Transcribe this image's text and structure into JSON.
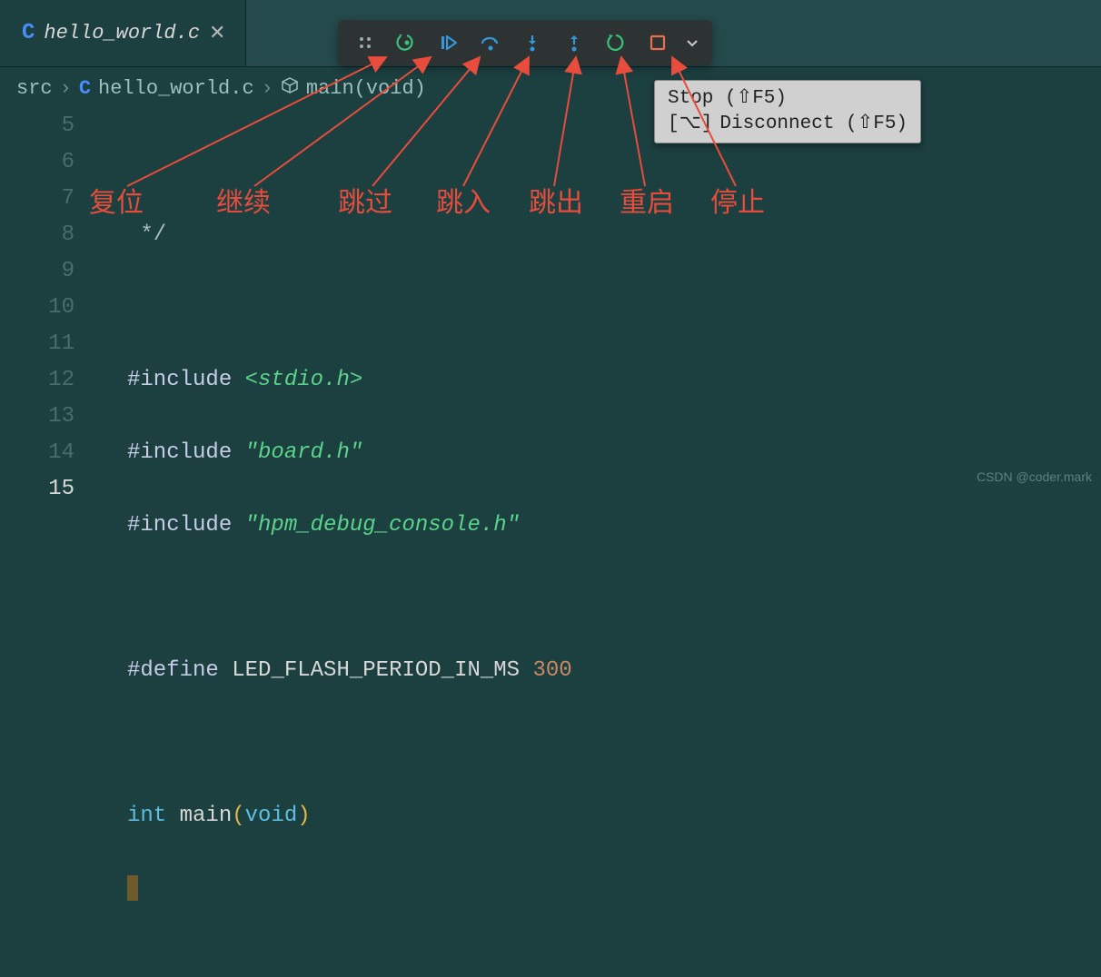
{
  "tab": {
    "icon_letter": "C",
    "filename": "hello_world.c",
    "close": "✕"
  },
  "debug": {
    "buttons": [
      {
        "name": "reset",
        "icon": "restart-back"
      },
      {
        "name": "continue",
        "icon": "play"
      },
      {
        "name": "step-over",
        "icon": "step-over"
      },
      {
        "name": "step-into",
        "icon": "step-in"
      },
      {
        "name": "step-out",
        "icon": "step-out"
      },
      {
        "name": "restart",
        "icon": "restart"
      },
      {
        "name": "stop",
        "icon": "stop"
      }
    ]
  },
  "breadcrumb": {
    "folder": "src",
    "file": "hello_world.c",
    "symbol": "main(void)"
  },
  "tooltip": {
    "line1": "Stop (⇧F5)",
    "line2_left": "[⌥]",
    "line2_rest": "Disconnect (⇧F5)"
  },
  "gutter_lines": [
    "5",
    "6",
    "7",
    "8",
    "9",
    "10",
    "11",
    "12",
    "13",
    "14",
    "15"
  ],
  "code_lines": {
    "l5": "",
    "l6": " */",
    "l7": "",
    "l8_a": "#include",
    "l8_b": "<stdio.h>",
    "l9_a": "#include",
    "l9_b": "\"board.h\"",
    "l10_a": "#include",
    "l10_b": "\"hpm_debug_console.h\"",
    "l11": "",
    "l12_a": "#define",
    "l12_b": "LED_FLASH_PERIOD_IN_MS",
    "l12_c": "300",
    "l13": "",
    "l14_a": "int",
    "l14_b": "main",
    "l14_c": "(",
    "l14_d": "void",
    "l14_e": ")"
  },
  "annotations": {
    "reset": "复位",
    "continue": "继续",
    "step_over": "跳过",
    "step_into": "跳入",
    "step_out": "跳出",
    "restart": "重启",
    "stop": "停止"
  },
  "watermark": "CSDN @coder.mark"
}
